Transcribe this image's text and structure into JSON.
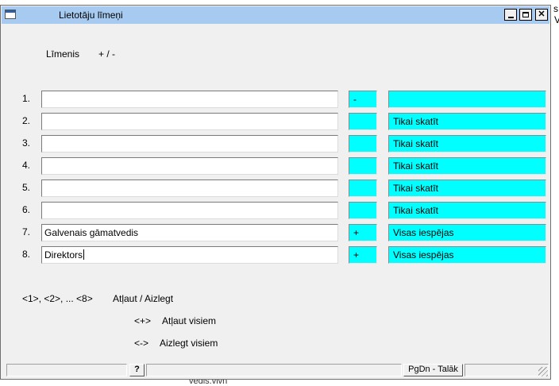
{
  "background": {
    "frag_top_right": "V",
    "frag_bottom": "vedis.vlvn"
  },
  "window": {
    "title": "Lietotāju līmeņi",
    "controls": {
      "minimize": "_",
      "maximize": "□",
      "close": "✕"
    }
  },
  "header": {
    "level_label": "Līmenis",
    "sign_label": "+ / -"
  },
  "rows": [
    {
      "num": "1.",
      "name": "",
      "sign": "-",
      "access": ""
    },
    {
      "num": "2.",
      "name": "",
      "sign": "",
      "access": "Tikai skatīt"
    },
    {
      "num": "3.",
      "name": "",
      "sign": "",
      "access": "Tikai skatīt"
    },
    {
      "num": "4.",
      "name": "",
      "sign": "",
      "access": "Tikai skatīt"
    },
    {
      "num": "5.",
      "name": "",
      "sign": "",
      "access": "Tikai skatīt"
    },
    {
      "num": "6.",
      "name": "",
      "sign": "",
      "access": "Tikai skatīt"
    },
    {
      "num": "7.",
      "name": "Galvenais gāmatvedis",
      "sign": "+",
      "access": "Visas iespējas"
    },
    {
      "num": "8.",
      "name": "Direktors",
      "sign": "+",
      "access": "Visas iespējas"
    }
  ],
  "help": {
    "line1_keys": "<1>, <2>, ... <8>",
    "line1_text": "Atļaut / Aizlegt",
    "line2_keys": "<+>",
    "line2_text": "Atļaut visiem",
    "line3_keys": "<->",
    "line3_text": "Aizlegt visiem"
  },
  "statusbar": {
    "help_button": "?",
    "next_button": "PgDn - Talāk"
  },
  "colors": {
    "titlebar": "#a6caf0",
    "field_accent": "#00ffff",
    "window_bg": "#f0f0f0"
  }
}
